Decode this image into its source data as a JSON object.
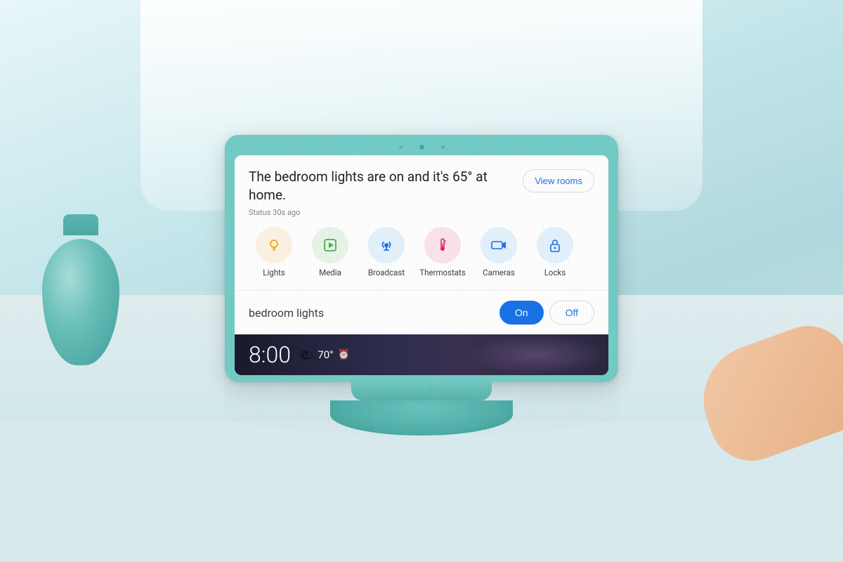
{
  "background": {
    "color_top": "#d8eef0",
    "color_bottom": "#c0dde2"
  },
  "device": {
    "color": "#74ccc6"
  },
  "screen": {
    "main_text": "The bedroom lights are on and it's 65° at home.",
    "status_text": "Status 30s ago",
    "view_rooms_label": "View rooms",
    "icons": [
      {
        "id": "lights",
        "label": "Lights",
        "bg": "lights",
        "symbol": "💡"
      },
      {
        "id": "media",
        "label": "Media",
        "bg": "media",
        "symbol": "▶"
      },
      {
        "id": "broadcast",
        "label": "Broadcast",
        "bg": "broadcast",
        "symbol": "📢"
      },
      {
        "id": "thermostats",
        "label": "Thermostats",
        "bg": "thermostats",
        "symbol": "🌡"
      },
      {
        "id": "cameras",
        "label": "Cameras",
        "bg": "cameras",
        "symbol": "📹"
      },
      {
        "id": "locks",
        "label": "Locks",
        "bg": "locks",
        "symbol": "🔒"
      }
    ],
    "lights_label": "bedroom lights",
    "on_label": "On",
    "off_label": "Off",
    "clock_time": "8:00",
    "weather_temp": "70°",
    "alarm_icon": "⏰"
  }
}
